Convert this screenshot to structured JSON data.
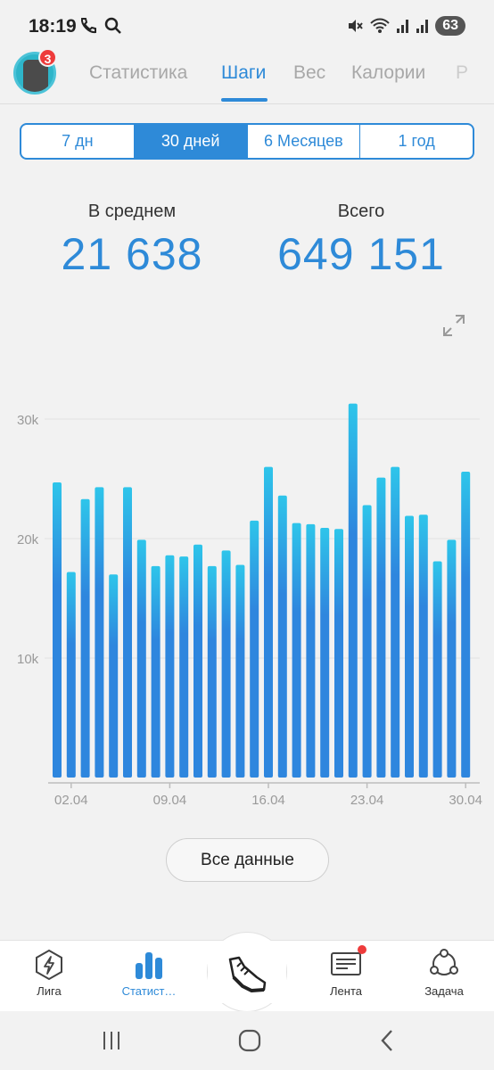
{
  "status_bar": {
    "time": "18:19",
    "battery": "63",
    "icons": [
      "call-icon",
      "search-icon",
      "mute-icon",
      "wifi-icon",
      "signal-icon",
      "signal-icon"
    ]
  },
  "avatar": {
    "badge_count": "3"
  },
  "top_tabs": [
    {
      "label": "Статистика",
      "active": false
    },
    {
      "label": "Шаги",
      "active": true
    },
    {
      "label": "Вес",
      "active": false
    },
    {
      "label": "Калории",
      "active": false
    },
    {
      "label": "Р",
      "active": false
    }
  ],
  "period_tabs": [
    {
      "label": "7 дн",
      "active": false
    },
    {
      "label": "30 дней",
      "active": true
    },
    {
      "label": "6 Месяцев",
      "active": false
    },
    {
      "label": "1 год",
      "active": false
    }
  ],
  "summary": {
    "average_label": "В среднем",
    "average_value": "21 638",
    "total_label": "Всего",
    "total_value": "649 151"
  },
  "chart_data": {
    "type": "bar",
    "categories": [
      "01.04",
      "02.04",
      "03.04",
      "04.04",
      "05.04",
      "06.04",
      "07.04",
      "08.04",
      "09.04",
      "10.04",
      "11.04",
      "12.04",
      "13.04",
      "14.04",
      "15.04",
      "16.04",
      "17.04",
      "18.04",
      "19.04",
      "20.04",
      "21.04",
      "22.04",
      "23.04",
      "24.04",
      "25.04",
      "26.04",
      "27.04",
      "28.04",
      "29.04",
      "30.04"
    ],
    "values": [
      24700,
      17200,
      23300,
      24300,
      17000,
      24300,
      19900,
      17700,
      18600,
      18500,
      19500,
      17700,
      19000,
      17800,
      21500,
      26000,
      23600,
      21300,
      21200,
      20900,
      20800,
      31300,
      22800,
      25100,
      26000,
      21900,
      22000,
      18100,
      19900,
      25600
    ],
    "x_tick_labels": [
      "02.04",
      "09.04",
      "16.04",
      "23.04",
      "30.04"
    ],
    "y_tick_labels": [
      "10k",
      "20k",
      "30k"
    ],
    "y_ticks": [
      10000,
      20000,
      30000
    ],
    "ylim": [
      0,
      33000
    ],
    "grid": true,
    "bar_color_top": "#2ec5ea",
    "bar_color_bottom": "#2e86de"
  },
  "all_data_button": "Все данные",
  "bottom_nav": [
    {
      "label": "Лига",
      "icon": "lightning-hexagon-icon",
      "active": false
    },
    {
      "label": "Статист…",
      "icon": "bar-chart-icon",
      "active": true
    },
    {
      "label": "",
      "icon": "sneaker-icon",
      "active": false
    },
    {
      "label": "Лента",
      "icon": "feed-icon",
      "active": false
    },
    {
      "label": "Задача",
      "icon": "people-group-icon",
      "active": false
    }
  ],
  "android_nav": [
    "recents-icon",
    "home-icon",
    "back-icon"
  ],
  "colors": {
    "accent": "#2e8ad8",
    "badge": "#ee3b3b",
    "background": "#f2f2f2"
  }
}
